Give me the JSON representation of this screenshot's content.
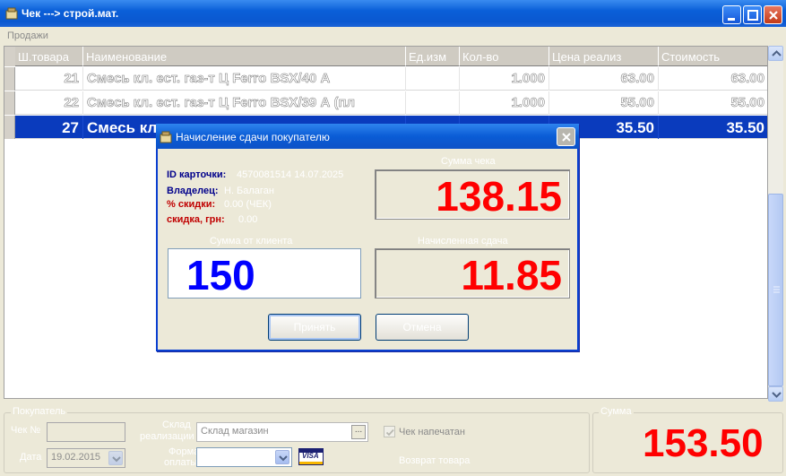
{
  "window": {
    "title": "Чек ---> строй.мат."
  },
  "menu": {
    "items": [
      "Продажи"
    ]
  },
  "grid": {
    "columns": [
      "Ш.товара",
      "Наименование",
      "Ед.изм",
      "Кол-во",
      "Цена реализ",
      "Стоимость"
    ],
    "rows": [
      {
        "code": "21",
        "name": "Смесь кл. ест. газ-т Ц Ferro BSX/40 А",
        "unit": "",
        "qty": "1.000",
        "price": "63.00",
        "cost": "63.00",
        "selected": false
      },
      {
        "code": "22",
        "name": "Смесь кл. ест. газ-т Ц Ferro BSX/39 А (пл",
        "unit": "",
        "qty": "1.000",
        "price": "55.00",
        "cost": "55.00",
        "selected": false
      },
      {
        "code": "27",
        "name": "Смесь кл",
        "unit": "",
        "qty": "",
        "price": "35.50",
        "cost": "35.50",
        "selected": true
      }
    ]
  },
  "dialog": {
    "title": "Начисление сдачи покупателю",
    "card_id_label": "ID карточки:",
    "card_id_value": "4570081514 14.07.2025",
    "owner_label": "Владелец:",
    "owner_value": "Н. Балаган",
    "discount_pct_label": "% скидки:",
    "discount_pct_value": "0.00 (ЧЕК)",
    "discount_uah_label": "скидка, грн:",
    "discount_uah_value": "0.00",
    "check_sum_caption": "Сумма чека",
    "check_sum": "138.15",
    "from_client_caption": "Сумма от клиента",
    "from_client": "150",
    "change_caption": "Начисленная сдача",
    "change": "11.85",
    "ok_label": "Принять",
    "cancel_label": "Отмена"
  },
  "footer": {
    "group_label": "Покупатель",
    "check_label": "Чек №",
    "check_value": "",
    "date_label": "Дата",
    "date_value": "19.02.2015",
    "warehouse_label": "Склад",
    "warehouse_sublabel": "реализации",
    "warehouse_value": "Склад магазин",
    "payment_label": "Форма",
    "payment_sublabel": "оплаты",
    "payment_value": "",
    "printed_label": "Чек напечатан",
    "printed_checked": true,
    "return_label": "Возврат товара",
    "visa_label": "VISA",
    "total_caption": "Сумма",
    "total": "153.50"
  },
  "colors": {
    "accent_red": "#ff0000",
    "accent_blue": "#0000ff",
    "selection": "#0a3bbd",
    "titlebar": "#0a5cd6"
  }
}
